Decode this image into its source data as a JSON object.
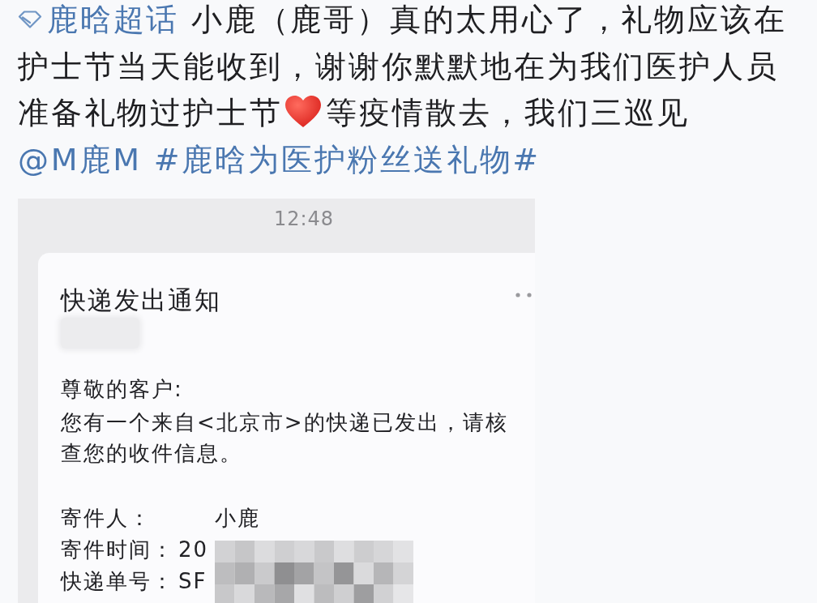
{
  "post": {
    "segments": [
      {
        "kind": "topic",
        "text": "鹿晗超话"
      },
      {
        "kind": "text",
        "text": "小鹿（鹿哥）真的太用心了，礼物应该在护士节当天能收到，谢谢你默默地在为我们医护人员准备礼物过护士节"
      },
      {
        "kind": "emoji"
      },
      {
        "kind": "text",
        "text": "等疫情散去，我们三巡见"
      },
      {
        "kind": "mention",
        "text": "@M鹿M"
      },
      {
        "kind": "hashtag",
        "text": "#鹿晗为医护粉丝送礼物#"
      }
    ]
  },
  "shared_screenshot": {
    "status_time": "12:48",
    "notification": {
      "title": "快递发出通知",
      "greeting": "尊敬的客户:",
      "message": "您有一个来自<北京市>的快递已发出，请核查您的收件信息。",
      "fields": [
        {
          "label": "寄件人：",
          "value": "小鹿"
        },
        {
          "label": "寄件时间：",
          "value": "20"
        },
        {
          "label": "快递单号：",
          "value": "SF"
        }
      ]
    }
  }
}
